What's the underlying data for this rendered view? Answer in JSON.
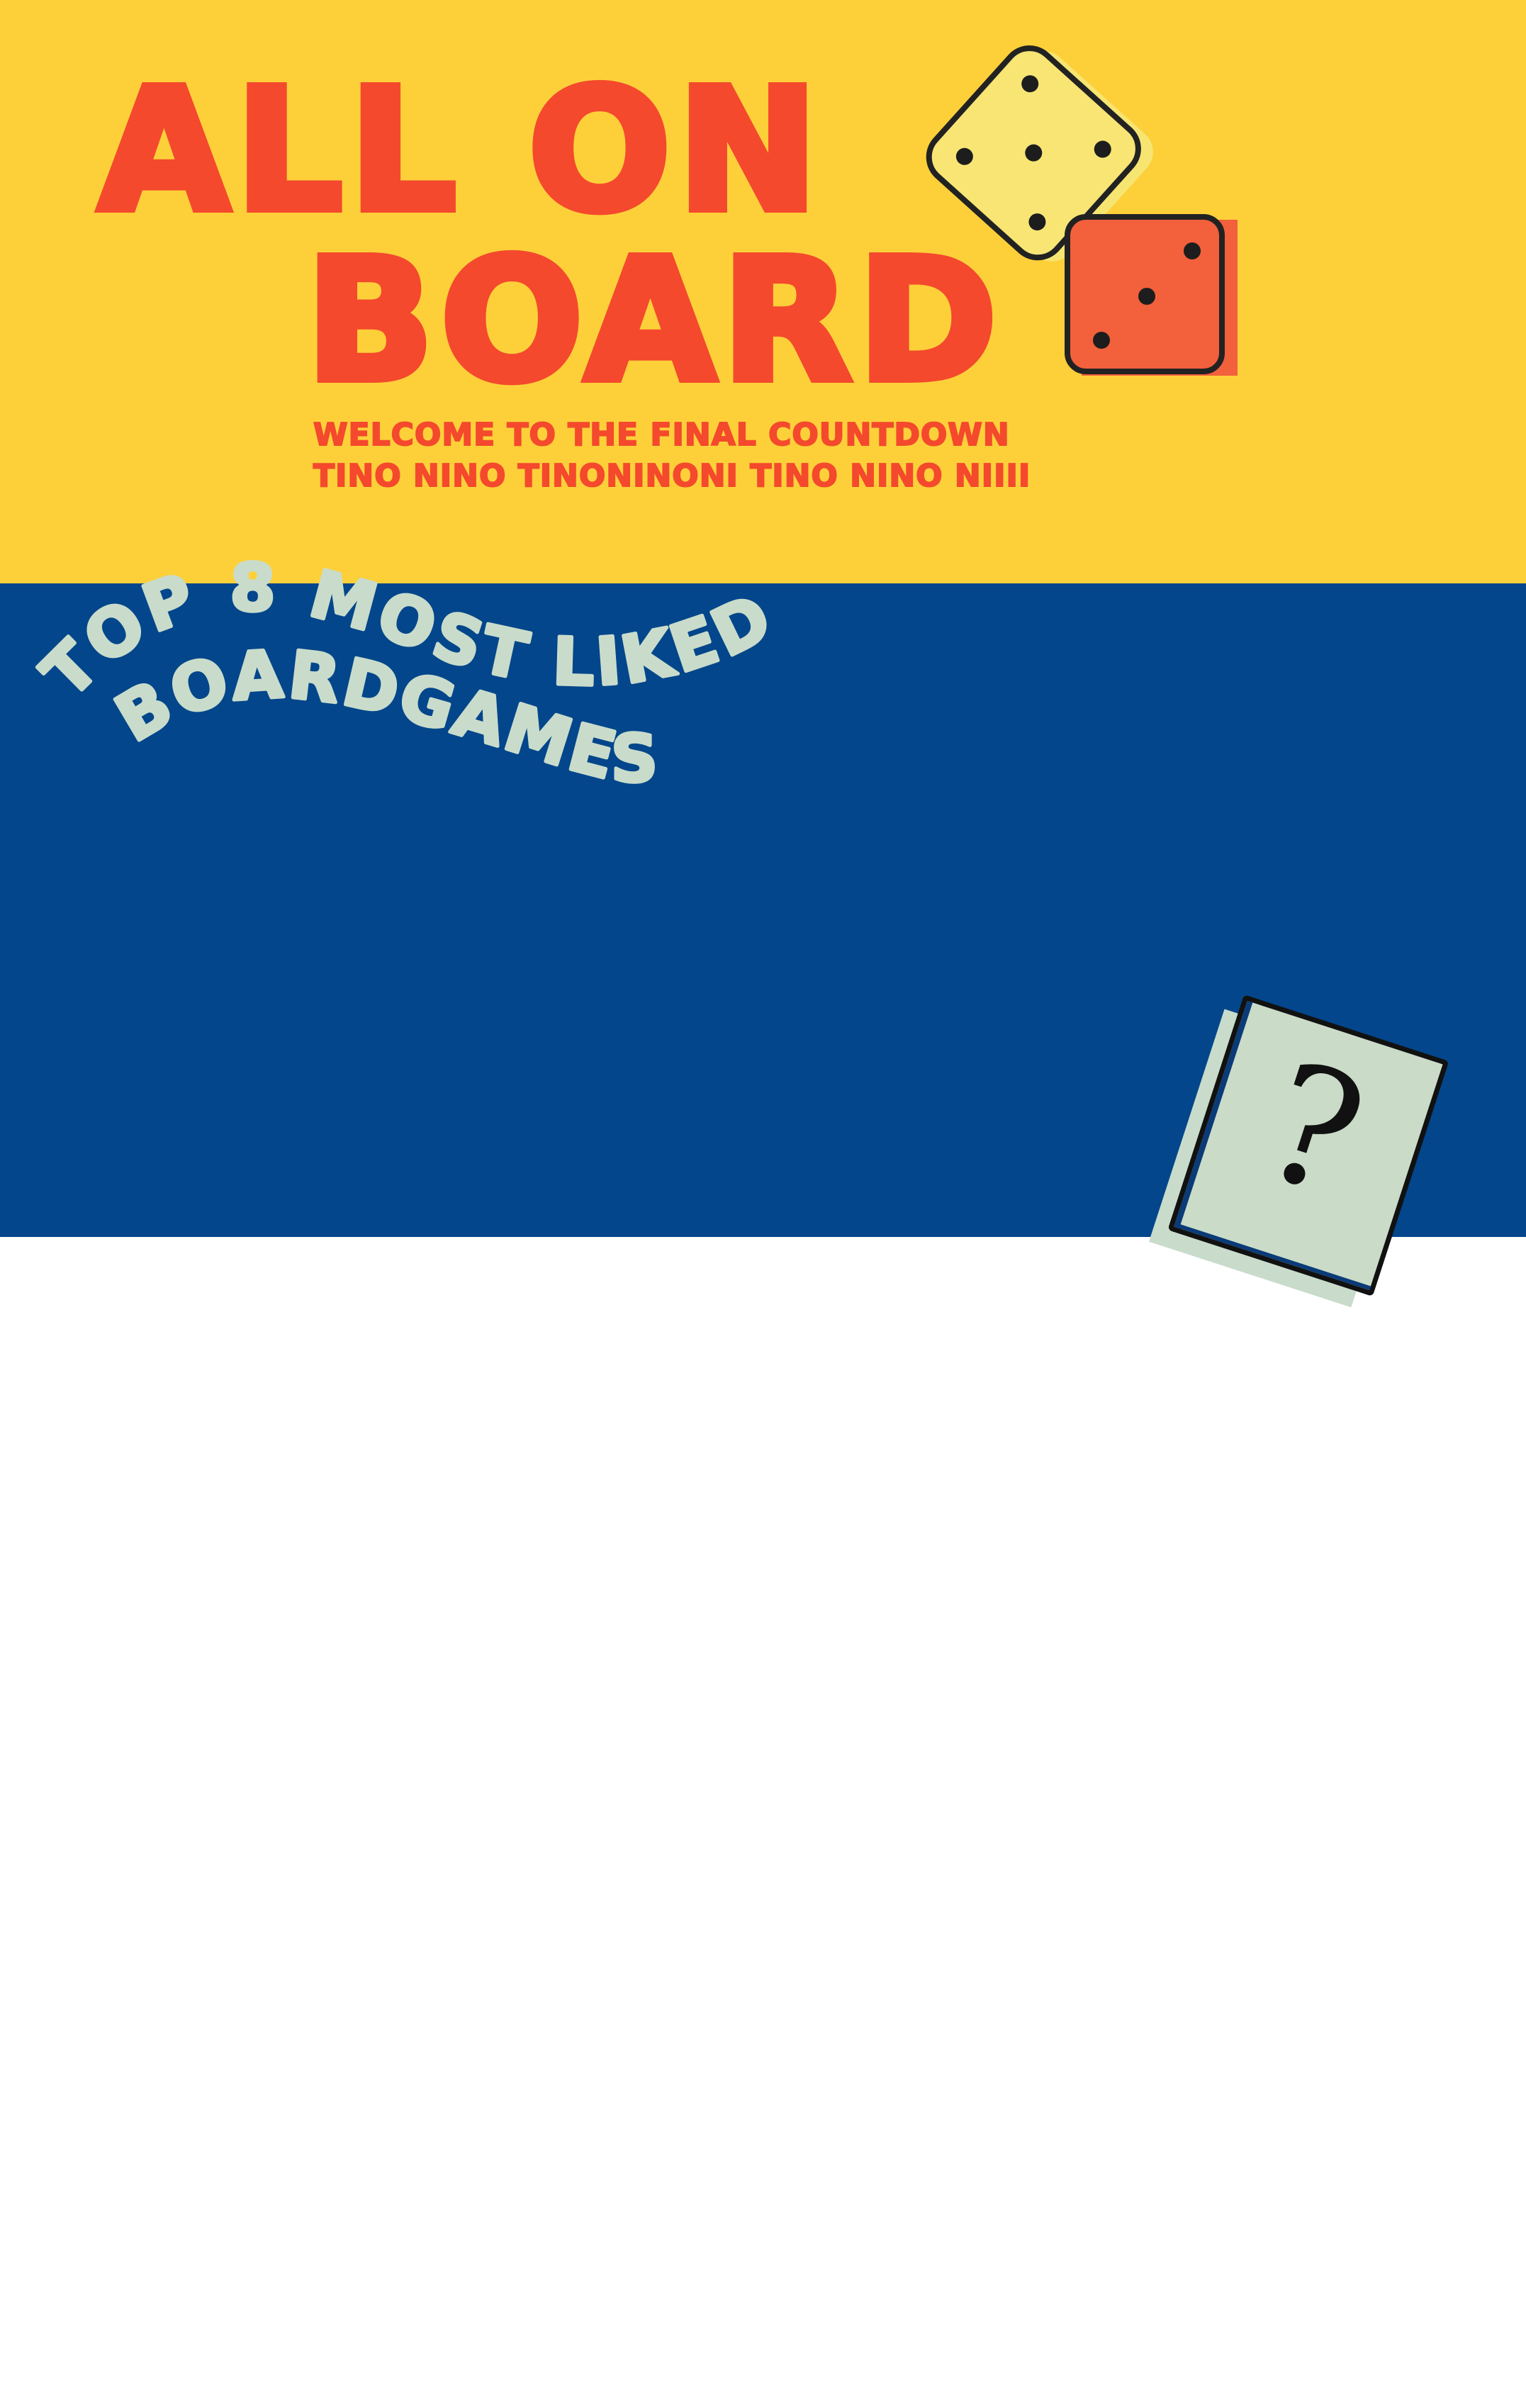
{
  "header": {
    "title_line_1": "ALL ON",
    "title_line_2": "BOARD",
    "tagline_line_1": "WELCOME TO THE FINAL  COUNTDOWN",
    "tagline_line_2": "TINO NINO TINONINONI TINO NINO NIIII",
    "background_color": "#fdd03a",
    "title_color": "#f4492d"
  },
  "dice": [
    {
      "name": "yellow-die",
      "color": "#f8e574",
      "pips": 5
    },
    {
      "name": "red-die",
      "color": "#f2603c",
      "pips": 3
    }
  ],
  "section": {
    "heading_line_1": "TOP 8 MOST LIKED",
    "heading_line_2": "BOARDGAMES",
    "background_color": "#03468b",
    "heading_color": "#c9dccb"
  },
  "mystery_card": {
    "symbol": "?",
    "color": "#cadbc8"
  }
}
